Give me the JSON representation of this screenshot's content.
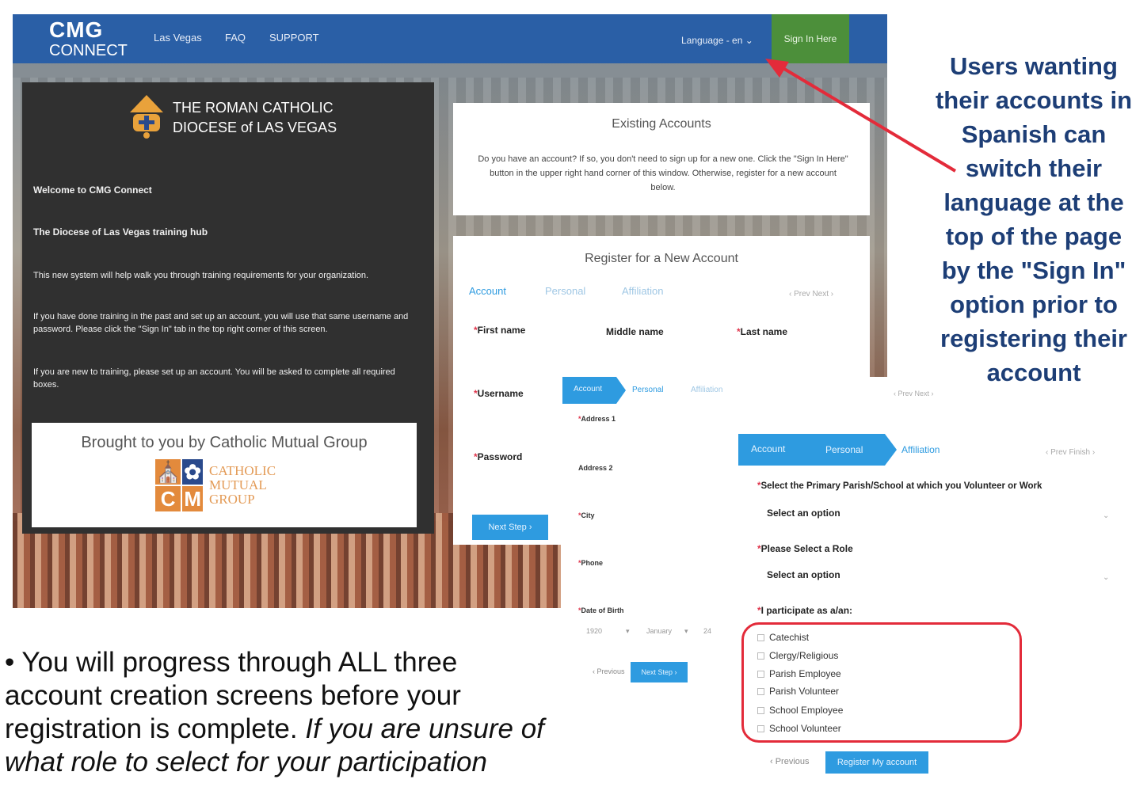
{
  "topbar": {
    "logo_line1": "CMG",
    "logo_line2": "CONNECT",
    "nav": [
      "Las Vegas",
      "FAQ",
      "SUPPORT"
    ],
    "language": "Language - en ⌄",
    "sign_in": "Sign In Here",
    "bar_color": "#2a5fa6",
    "signin_color": "#4c8f3a"
  },
  "left_panel": {
    "diocese_line1": "THE ROMAN CATHOLIC",
    "diocese_line2": "DIOCESE of LAS VEGAS",
    "welcome": "Welcome to CMG Connect",
    "hub": "The Diocese of Las Vegas training hub",
    "p1": "This new system will help walk you through training requirements for your organization.",
    "p2": "If you have done training in the past and set up an account, you will use that same username and password. Please click the \"Sign In\" tab in the top right corner of this screen.",
    "p3": "If you are new to training, please set up an account. You will be asked to complete all required boxes.",
    "brought_by": "Brought to you by Catholic Mutual Group",
    "cmg_word1": "CATHOLIC",
    "cmg_word2": "MUTUAL",
    "cmg_word3": "GROUP"
  },
  "existing": {
    "title": "Existing Accounts",
    "body": "Do you have an account? If so, you don't need to sign up for a new one. Click the \"Sign In Here\" button in the upper right hand corner of this window. Otherwise, register for a new account below."
  },
  "register": {
    "title": "Register for a New Account",
    "tabs": [
      "Account",
      "Personal",
      "Affiliation"
    ],
    "prev_next": "‹ Prev  Next ›",
    "first_name": "First name",
    "middle_name": "Middle name",
    "last_name": "Last name",
    "username": "Username",
    "password": "Password",
    "next_step": "Next Step ›"
  },
  "personal_step": {
    "tabs": [
      "Account",
      "Personal",
      "Affiliation"
    ],
    "prev_next": "‹ Prev  Next ›",
    "address1": "Address 1",
    "address2": "Address 2",
    "city": "City",
    "phone": "Phone",
    "dob": "Date of Birth",
    "dob_year": "1920",
    "dob_month": "January",
    "dob_day": "24",
    "previous": "‹ Previous",
    "next_step": "Next Step ›"
  },
  "affiliation_step": {
    "tabs": [
      "Account",
      "Personal",
      "Affiliation"
    ],
    "prev_finish": "‹ Prev  Finish ›",
    "parish_label": "Select the Primary Parish/School at which you Volunteer or Work",
    "parish_value": "Select an option",
    "role_label": "Please Select a Role",
    "role_value": "Select an option",
    "participate_label": "I participate as a/an:",
    "options": [
      "Catechist",
      "Clergy/Religious",
      "Parish Employee",
      "Parish Volunteer",
      "School Employee",
      "School Volunteer"
    ],
    "previous": "‹ Previous",
    "register": "Register My account",
    "frame_color": "#e32b3a"
  },
  "annotations": {
    "right": "Users wanting their accounts in Spanish can switch their language at the top of the page by the \"Sign In\" option prior to registering their account",
    "bottom_plain": "• You will progress through ALL three account creation screens before your registration is complete.",
    "bottom_italic": "If you are unsure of what role to select for your participation",
    "arrow_color": "#e32b3a",
    "text_color": "#1d3e76"
  }
}
